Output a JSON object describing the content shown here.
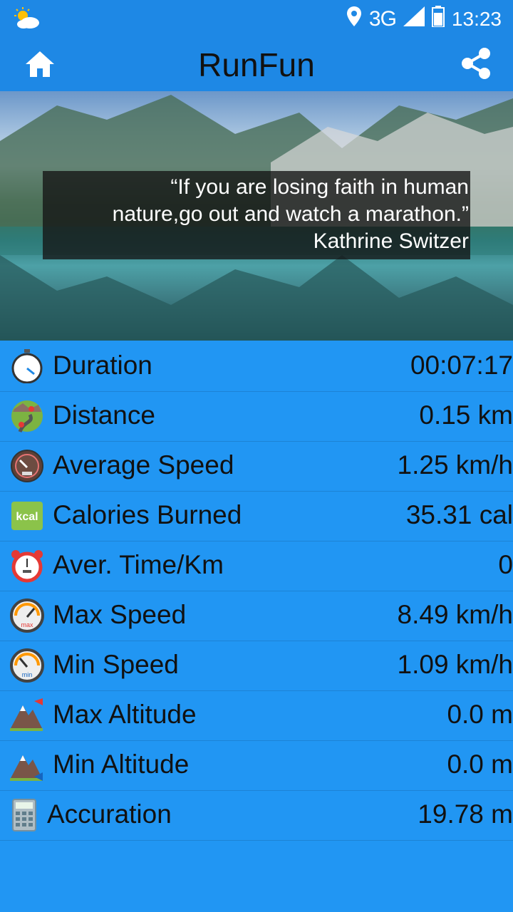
{
  "status_bar": {
    "network": "3G",
    "time": "13:23"
  },
  "toolbar": {
    "title": "RunFun"
  },
  "banner": {
    "quote_line1": "“If you are losing faith in human",
    "quote_line2": "nature,go out and watch a marathon.”",
    "author": "Kathrine Switzer"
  },
  "stats": [
    {
      "label": "Duration",
      "value": "00:07:17",
      "icon": "stopwatch-icon"
    },
    {
      "label": "Distance",
      "value": "0.15 km",
      "icon": "route-map-icon"
    },
    {
      "label": "Average Speed",
      "value": "1.25 km/h",
      "icon": "speedometer-icon"
    },
    {
      "label": "Calories Burned",
      "value": "35.31 cal",
      "icon": "kcal-icon"
    },
    {
      "label": "Aver. Time/Km",
      "value": "0",
      "icon": "alarm-clock-icon"
    },
    {
      "label": "Max Speed",
      "value": "8.49 km/h",
      "icon": "max-gauge-icon"
    },
    {
      "label": "Min Speed",
      "value": "1.09 km/h",
      "icon": "min-gauge-icon"
    },
    {
      "label": "Max Altitude",
      "value": "0.0 m",
      "icon": "mountain-up-icon"
    },
    {
      "label": "Min Altitude",
      "value": "0.0 m",
      "icon": "mountain-down-icon"
    },
    {
      "label": "Accuration",
      "value": "19.78 m",
      "icon": "calculator-icon"
    }
  ],
  "colors": {
    "background": "#2196F3",
    "toolbar": "#1E88E5",
    "kcal_badge": "#8BC34A"
  }
}
